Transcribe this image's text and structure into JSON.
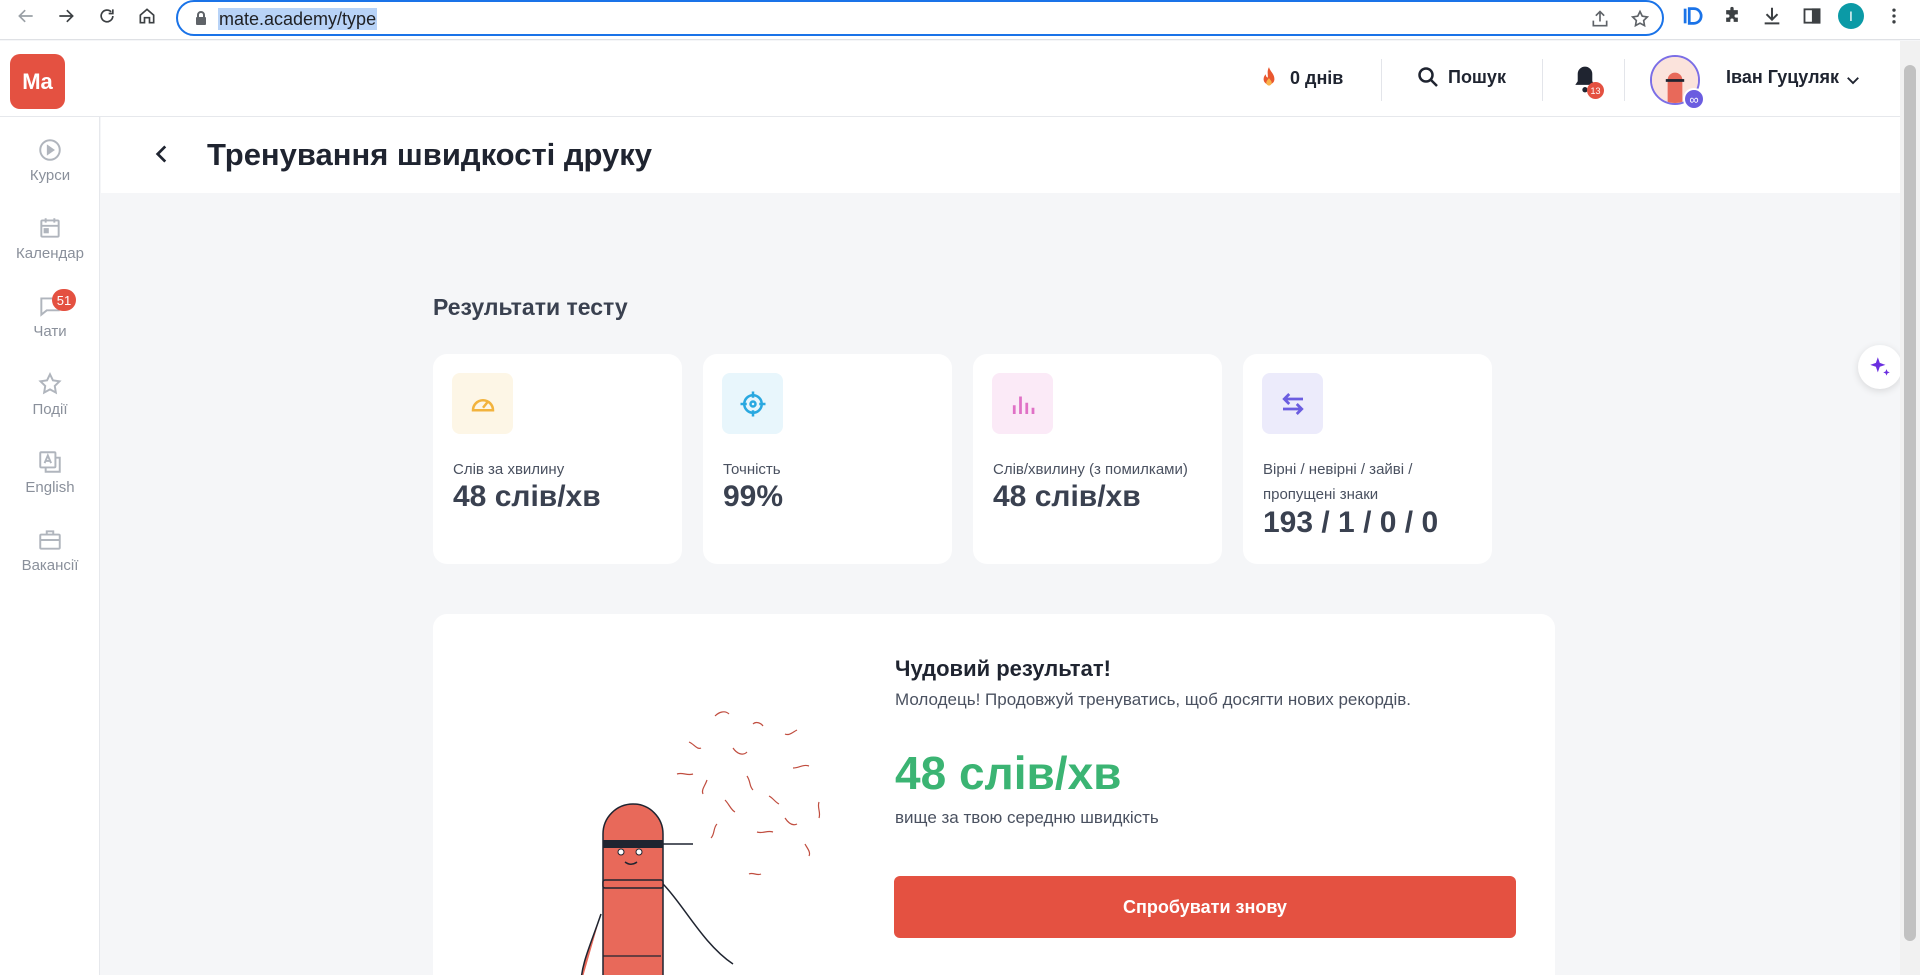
{
  "browser": {
    "url": "mate.academy/type",
    "profile_initial": "I"
  },
  "header": {
    "logo": "Ma",
    "streak": "0 днів",
    "search_label": "Пошук",
    "notification_count": "13",
    "user_name": "Іван Гуцуляк"
  },
  "sidebar": {
    "items": [
      {
        "label": "Курси",
        "icon": "play-circle-icon"
      },
      {
        "label": "Календар",
        "icon": "calendar-icon"
      },
      {
        "label": "Чати",
        "icon": "chat-icon",
        "badge": "51"
      },
      {
        "label": "Події",
        "icon": "star-icon"
      },
      {
        "label": "English",
        "icon": "translate-icon"
      },
      {
        "label": "Вакансії",
        "icon": "briefcase-icon"
      }
    ]
  },
  "page": {
    "title": "Тренування швидкості друку"
  },
  "results": {
    "section_title": "Результати тесту",
    "stats": [
      {
        "label": "Слів за хвилину",
        "value": "48 слів/хв",
        "icon": "speedometer-icon",
        "icon_color": "#f2b33d",
        "bg": "#fdf6e6"
      },
      {
        "label": "Точність",
        "value": "99%",
        "icon": "crosshair-icon",
        "icon_color": "#29a8e0",
        "bg": "#e8f6fc"
      },
      {
        "label": "Слів/хвилину (з помилками)",
        "value": "48 слів/хв",
        "icon": "bar-chart-icon",
        "icon_color": "#e071c6",
        "bg": "#fbeaf7"
      },
      {
        "label": "Вірні / невірні / зайві / пропущені знаки",
        "value": "193 / 1 / 0 / 0",
        "icon": "swap-arrows-icon",
        "icon_color": "#6b5de0",
        "bg": "#ecebfb"
      }
    ]
  },
  "summary": {
    "heading": "Чудовий результат!",
    "subtitle": "Молодець! Продовжуй тренуватись, щоб досягти нових рекордів.",
    "wpm": "48 слів/хв",
    "note": "вище за твою середню швидкість",
    "retry_label": "Спробувати знову"
  },
  "colors": {
    "brand": "#e45141",
    "success": "#3bb473",
    "accent": "#6b5de0"
  }
}
